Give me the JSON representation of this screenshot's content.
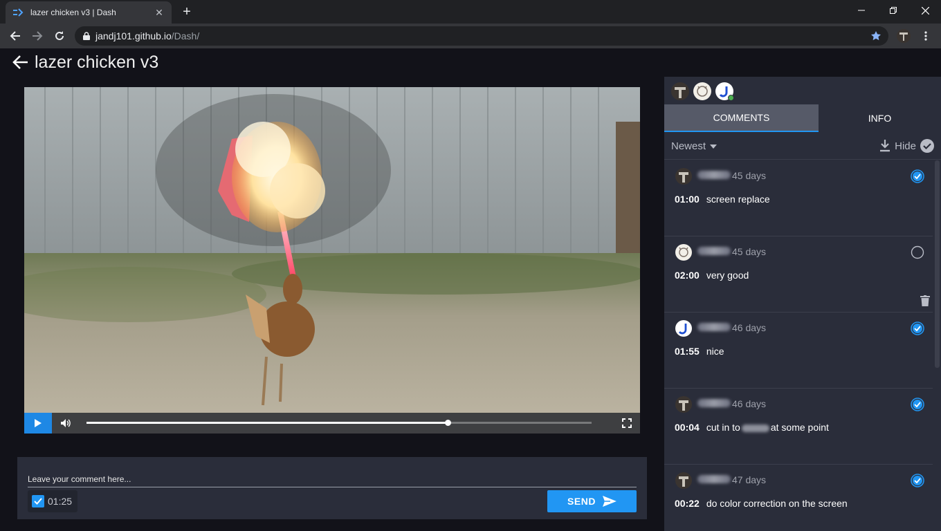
{
  "browser": {
    "tab_title": "lazer chicken v3 | Dash",
    "url_host": "jandj101.github.io",
    "url_path": "/Dash/"
  },
  "header": {
    "title": "lazer chicken v3"
  },
  "player": {
    "progress": 0.715
  },
  "composer": {
    "placeholder": "Leave your comment here...",
    "timestamp": "01:25",
    "timestamp_checked": true,
    "send_label": "SEND"
  },
  "panel": {
    "tabs": [
      "COMMENTS",
      "INFO"
    ],
    "active_tab": "COMMENTS",
    "sort_label": "Newest",
    "hide_label": "Hide"
  },
  "comments": [
    {
      "age": "45 days",
      "time": "01:00",
      "text": "screen replace",
      "resolved": true,
      "avatar": "dark"
    },
    {
      "age": "45 days",
      "time": "02:00",
      "text": "very good",
      "resolved": false,
      "avatar": "sketch",
      "deletable": true
    },
    {
      "age": "46 days",
      "time": "01:55",
      "text": "nice",
      "resolved": true,
      "avatar": "j"
    },
    {
      "age": "46 days",
      "time": "00:04",
      "text_before": "cut in to",
      "text_after": "at some point",
      "resolved": true,
      "avatar": "dark"
    },
    {
      "age": "47 days",
      "time": "00:22",
      "text": "do color correction on the screen",
      "resolved": true,
      "avatar": "dark"
    }
  ],
  "colors": {
    "accent": "#2196f3",
    "panel": "#2a2d3a",
    "background": "#121219"
  }
}
